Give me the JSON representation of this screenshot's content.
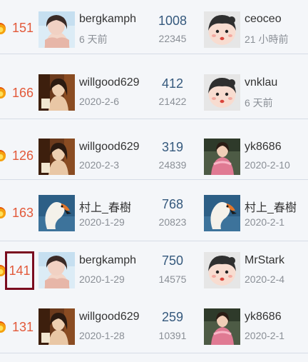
{
  "rows": [
    {
      "rank": "151",
      "poster_name": "bergkamph",
      "poster_date": "6 天前",
      "replies": "1008",
      "views": "22345",
      "last_name": "ceoceo",
      "last_date": "21 小時前",
      "poster_avatar": "girl-photo",
      "last_avatar": "cartoon-face"
    },
    {
      "rank": "166",
      "poster_name": "willgood629",
      "poster_date": "2020-2-6",
      "replies": "412",
      "views": "21422",
      "last_name": "vnklau",
      "last_date": "6 天前",
      "poster_avatar": "woman-photo",
      "last_avatar": "cartoon-face"
    },
    {
      "rank": "126",
      "poster_name": "willgood629",
      "poster_date": "2020-2-3",
      "replies": "319",
      "views": "24839",
      "last_name": "yk8686",
      "last_date": "2020-2-10",
      "poster_avatar": "woman-photo",
      "last_avatar": "pink-photo"
    },
    {
      "rank": "163",
      "poster_name": "村上_春樹",
      "poster_date": "2020-1-29",
      "replies": "768",
      "views": "20823",
      "last_name": "村上_春樹",
      "last_date": "2020-2-1",
      "poster_avatar": "swan-photo",
      "last_avatar": "swan-photo"
    },
    {
      "rank": "141",
      "poster_name": "bergkamph",
      "poster_date": "2020-1-29",
      "replies": "750",
      "views": "14575",
      "last_name": "MrStark",
      "last_date": "2020-2-4",
      "poster_avatar": "girl-photo",
      "last_avatar": "cartoon-face",
      "selected": true
    },
    {
      "rank": "131",
      "poster_name": "willgood629",
      "poster_date": "2020-1-28",
      "replies": "259",
      "views": "10391",
      "last_name": "yk8686",
      "last_date": "2020-2-1",
      "poster_avatar": "woman-photo",
      "last_avatar": "pink-photo"
    }
  ],
  "colors": {
    "rank": "#e2593a",
    "replies": "#35597d",
    "muted": "#8a8f96",
    "selection": "#7a0c1f",
    "background": "#f4f6f9"
  }
}
